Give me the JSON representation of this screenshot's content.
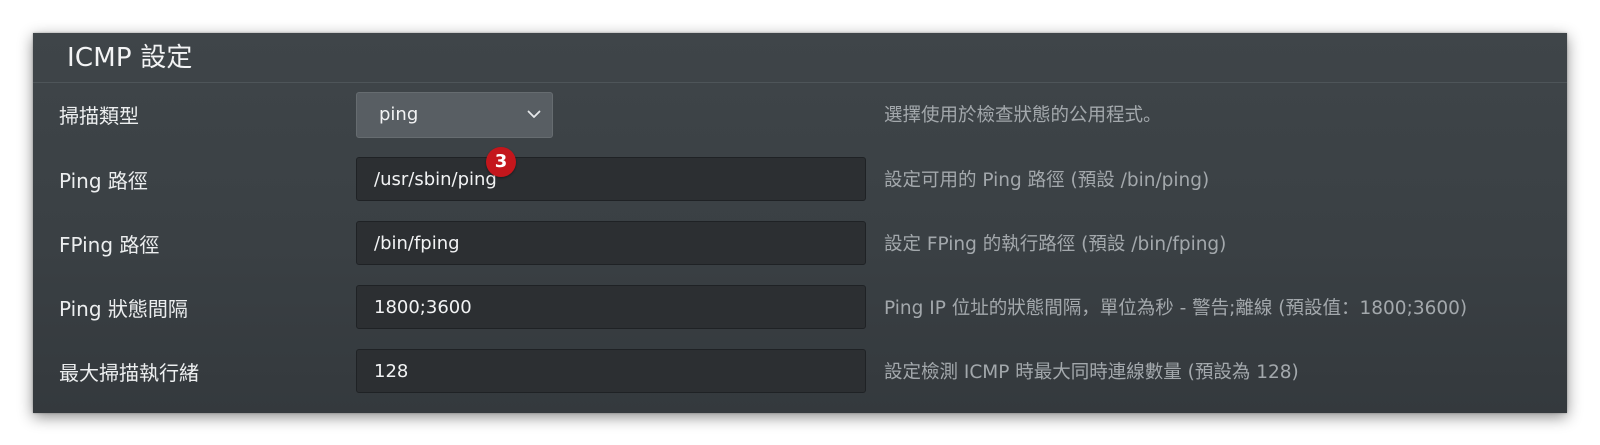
{
  "section": {
    "title": "ICMP 設定"
  },
  "rows": [
    {
      "label": "掃描類型",
      "type": "select",
      "value": "ping",
      "description": "選擇使用於檢查狀態的公用程式。"
    },
    {
      "label": "Ping 路徑",
      "type": "text",
      "value": "/usr/sbin/ping",
      "description": "設定可用的 Ping 路徑 (預設 /bin/ping)"
    },
    {
      "label": "FPing 路徑",
      "type": "text",
      "value": "/bin/fping",
      "description": "設定 FPing 的執行路徑 (預設 /bin/fping)"
    },
    {
      "label": "Ping 狀態間隔",
      "type": "text",
      "value": "1800;3600",
      "description": "Ping IP 位址的狀態間隔，單位為秒 - 警告;離線 (預設值：1800;3600)"
    },
    {
      "label": "最大掃描執行緒",
      "type": "text",
      "value": "128",
      "description": "設定檢測 ICMP 時最大同時連線數量 (預設為 128)"
    }
  ],
  "annotation": {
    "badge": "3"
  },
  "icons": {
    "select_arrow": "chevron-down-icon"
  },
  "colors": {
    "badge": "#c4161c",
    "panel": "#3d4347",
    "input": "#2c2f32"
  }
}
